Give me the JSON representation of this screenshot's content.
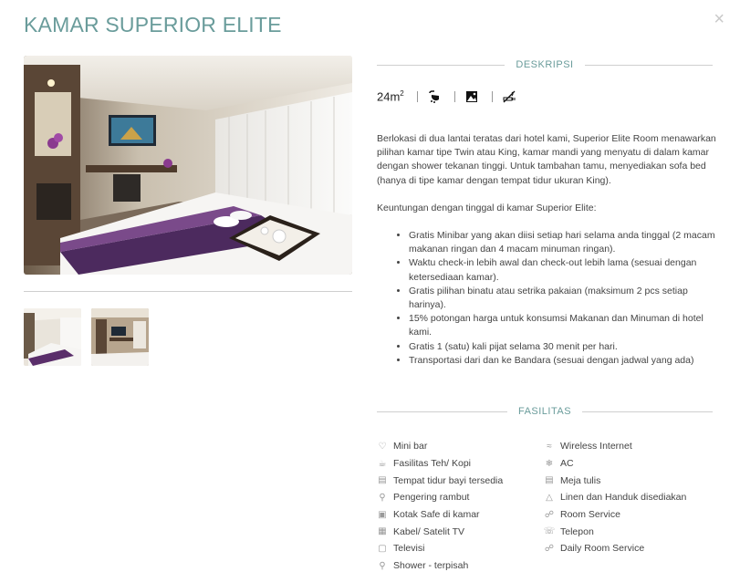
{
  "modal": {
    "title": "KAMAR SUPERIOR ELITE",
    "close_label": "×"
  },
  "colors": {
    "accent": "#6a9c9b",
    "rule": "#cfcfcf",
    "text": "#444444"
  },
  "gallery": {
    "main_photo_alt": "hotel room photo",
    "thumbnails": [
      {
        "name": "thumbnail-1"
      },
      {
        "name": "thumbnail-2"
      }
    ]
  },
  "description": {
    "heading": "DESKRIPSI",
    "room_size": "24m",
    "room_size_unit_sup": "2",
    "quick_icons": [
      "shower-icon",
      "image-icon",
      "no-smoking-icon"
    ],
    "paragraph_1": "Berlokasi di dua lantai teratas dari hotel kami, Superior Elite Room menawarkan pilihan kamar tipe Twin atau King, kamar mandi yang menyatu di dalam kamar dengan shower tekanan tinggi. Untuk tambahan tamu, menyediakan sofa bed (hanya di tipe kamar dengan tempat tidur ukuran King).",
    "paragraph_2": "Keuntungan dengan tinggal di kamar Superior Elite:",
    "benefits": [
      "Gratis Minibar yang akan diisi setiap hari selama anda tinggal (2 macam makanan ringan dan 4 macam minuman ringan).",
      "Waktu check-in lebih awal dan check-out lebih lama (sesuai dengan ketersediaan kamar).",
      "Gratis pilihan binatu atau setrika pakaian (maksimum 2 pcs setiap harinya).",
      "15% potongan harga untuk konsumsi Makanan dan Minuman di hotel kami.",
      "Gratis 1 (satu) kali pijat selama 30 menit per hari.",
      "Transportasi dari dan ke Bandara (sesuai dengan jadwal yang ada)"
    ]
  },
  "facilities": {
    "heading": "FASILITAS",
    "left": [
      {
        "label": "Mini bar",
        "icon": "bottle-icon"
      },
      {
        "label": "Fasilitas Teh/ Kopi",
        "icon": "cup-icon"
      },
      {
        "label": "Tempat tidur bayi tersedia",
        "icon": "crib-icon"
      },
      {
        "label": "Pengering rambut",
        "icon": "hairdryer-icon"
      },
      {
        "label": "Kotak Safe di kamar",
        "icon": "safe-icon"
      },
      {
        "label": "Kabel/ Satelit TV",
        "icon": "satellite-tv-icon"
      },
      {
        "label": "Televisi",
        "icon": "tv-icon"
      },
      {
        "label": "Shower - terpisah",
        "icon": "shower-icon"
      }
    ],
    "right": [
      {
        "label": "Wireless Internet",
        "icon": "wifi-icon"
      },
      {
        "label": "AC",
        "icon": "snowflake-icon"
      },
      {
        "label": "Meja tulis",
        "icon": "desk-icon"
      },
      {
        "label": "Linen dan Handuk disediakan",
        "icon": "linen-icon"
      },
      {
        "label": "Room Service",
        "icon": "room-service-icon"
      },
      {
        "label": "Telepon",
        "icon": "phone-icon"
      },
      {
        "label": "Daily Room Service",
        "icon": "daily-service-icon"
      }
    ]
  }
}
